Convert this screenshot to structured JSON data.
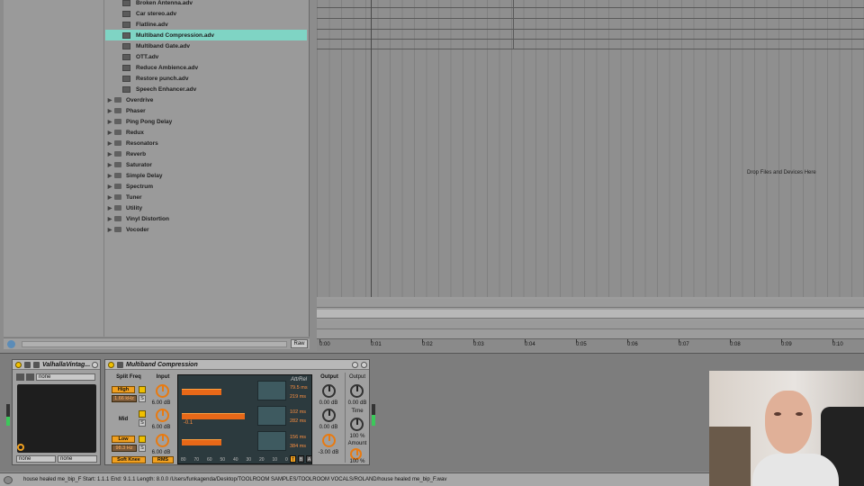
{
  "browser": {
    "items": [
      {
        "label": "Broken Antenna.adv",
        "type": "file",
        "selected": false
      },
      {
        "label": "Car stereo.adv",
        "type": "file",
        "selected": false
      },
      {
        "label": "Flatline.adv",
        "type": "file",
        "selected": false
      },
      {
        "label": "Multiband Compression.adv",
        "type": "file",
        "selected": true
      },
      {
        "label": "Multiband Gate.adv",
        "type": "file",
        "selected": false
      },
      {
        "label": "OTT.adv",
        "type": "file",
        "selected": false
      },
      {
        "label": "Reduce Ambience.adv",
        "type": "file",
        "selected": false
      },
      {
        "label": "Restore punch.adv",
        "type": "file",
        "selected": false
      },
      {
        "label": "Speech Enhancer.adv",
        "type": "file",
        "selected": false
      },
      {
        "label": "Overdrive",
        "type": "folder",
        "selected": false
      },
      {
        "label": "Phaser",
        "type": "folder",
        "selected": false
      },
      {
        "label": "Ping Pong Delay",
        "type": "folder",
        "selected": false
      },
      {
        "label": "Redux",
        "type": "folder",
        "selected": false
      },
      {
        "label": "Resonators",
        "type": "folder",
        "selected": false
      },
      {
        "label": "Reverb",
        "type": "folder",
        "selected": false
      },
      {
        "label": "Saturator",
        "type": "folder",
        "selected": false
      },
      {
        "label": "Simple Delay",
        "type": "folder",
        "selected": false
      },
      {
        "label": "Spectrum",
        "type": "folder",
        "selected": false
      },
      {
        "label": "Tuner",
        "type": "folder",
        "selected": false
      },
      {
        "label": "Utility",
        "type": "folder",
        "selected": false
      },
      {
        "label": "Vinyl Distortion",
        "type": "folder",
        "selected": false
      },
      {
        "label": "Vocoder",
        "type": "folder",
        "selected": false
      }
    ],
    "selected_color": "#7fd4c4",
    "preview_raw_label": "Raw"
  },
  "arrangement": {
    "drop_text": "Drop Files and Devices Here",
    "ruler": [
      "0:00",
      "0:01",
      "0:02",
      "0:03",
      "0:04",
      "0:05",
      "0:06",
      "0:07",
      "0:08",
      "0:09",
      "0:10"
    ]
  },
  "valhalla": {
    "title": "ValhallaVintag...",
    "preset": "none",
    "select_left": "none",
    "select_right": "none"
  },
  "multiband": {
    "title": "Multiband Compression",
    "split_freq_label": "Split Freq",
    "input_label": "Input",
    "output_label": "Output",
    "high_label": "High",
    "high_freq": "1.66 kHz",
    "mid_label": "Mid",
    "low_label": "Low",
    "low_freq": "98.3 Hz",
    "solo_label": "S",
    "input_high": "6.00 dB",
    "input_mid": "6.00 dB",
    "input_low": "6.00 dB",
    "out_high": "0.00 dB",
    "out_mid": "0.00 dB",
    "out_low": "-3.00 dB",
    "att_rel_label": "Att/Rel",
    "att_high": "79.5 ms",
    "rel_high": "219 ms",
    "att_mid": "102 ms",
    "rel_mid": "282 ms",
    "att_low": "156 ms",
    "rel_low": "384 ms",
    "mid_threshold": "-0.1",
    "scale": [
      "80",
      "70",
      "60",
      "50",
      "40",
      "30",
      "20",
      "10",
      "0"
    ],
    "soft_knee_label": "Soft Knee",
    "rms_label": "RMS",
    "mode_labels": [
      "T",
      "B",
      "A"
    ],
    "master_output_label": "Output",
    "master_output_value": "0.00 dB",
    "time_label": "Time",
    "time_value": "100 %",
    "amount_label": "Amount",
    "amount_value": "100 %",
    "accent_color": "#f0a020"
  },
  "status": {
    "text": "house healed me_bip_F  Start: 1.1.1  End: 9.1.1  Length: 8.0.0  /Users/funkagenda/Desktop/TOOLROOM SAMPLES/TOOLROOM VOCALS/ROLAND/house healed me_bip_F.wav"
  }
}
